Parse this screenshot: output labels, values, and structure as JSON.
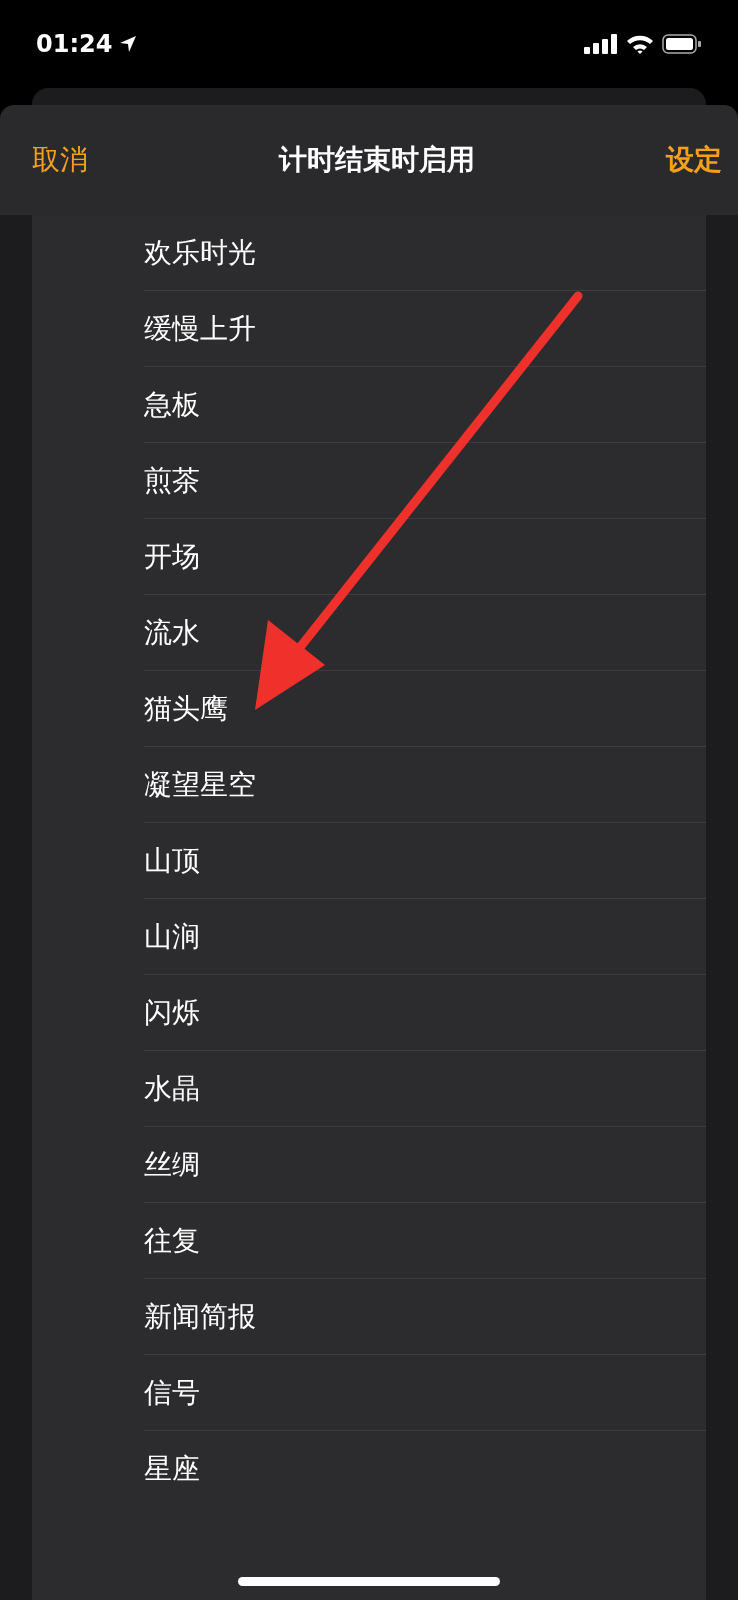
{
  "status_bar": {
    "time": "01:24"
  },
  "header": {
    "cancel": "取消",
    "title": "计时结束时启用",
    "confirm": "设定"
  },
  "sounds": [
    {
      "name": "欢乐时光"
    },
    {
      "name": "缓慢上升"
    },
    {
      "name": "急板"
    },
    {
      "name": "煎茶"
    },
    {
      "name": "开场"
    },
    {
      "name": "流水"
    },
    {
      "name": "猫头鹰"
    },
    {
      "name": "凝望星空"
    },
    {
      "name": "山顶"
    },
    {
      "name": "山涧"
    },
    {
      "name": "闪烁"
    },
    {
      "name": "水晶"
    },
    {
      "name": "丝绸"
    },
    {
      "name": "往复"
    },
    {
      "name": "新闻简报"
    },
    {
      "name": "信号"
    },
    {
      "name": "星座"
    }
  ]
}
